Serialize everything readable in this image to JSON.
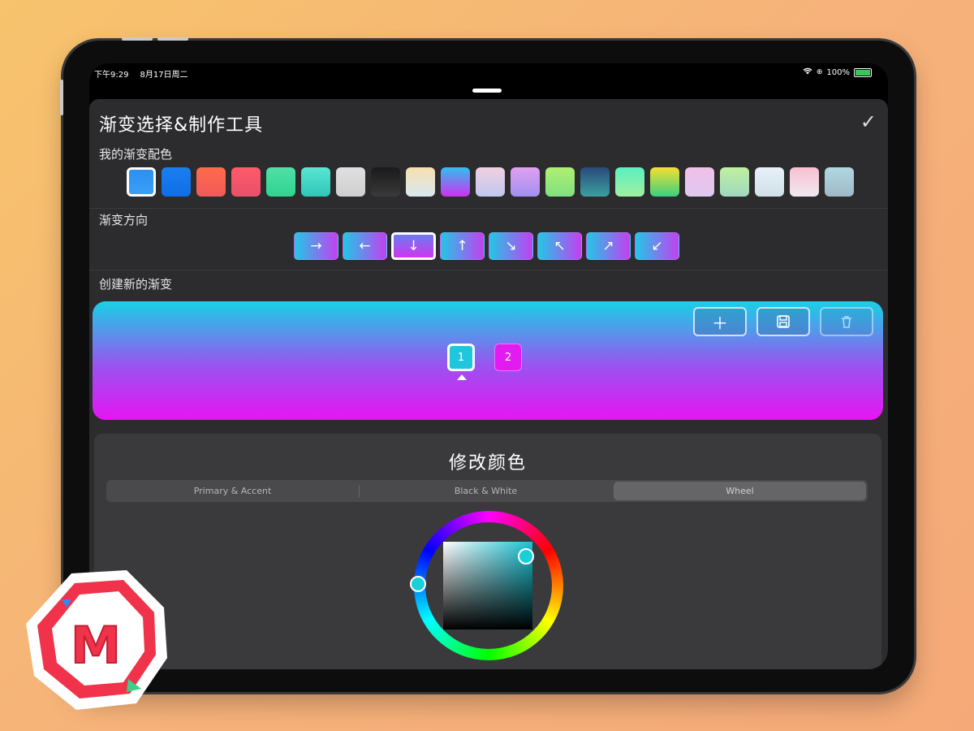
{
  "status_bar": {
    "time": "下午9:29",
    "date": "8月17日周二",
    "battery": "100%"
  },
  "header": {
    "title": "渐变选择&制作工具",
    "done_icon": "checkmark-icon"
  },
  "my_gradients": {
    "label": "我的渐变配色",
    "swatches": [
      {
        "from": "#2b8ff2",
        "to": "#3aa0f5"
      },
      {
        "from": "#1a7ff0",
        "to": "#0f6ee6"
      },
      {
        "from": "#ff6a4a",
        "to": "#f05a5a"
      },
      {
        "from": "#ff5a6a",
        "to": "#e8506a"
      },
      {
        "from": "#4fe0a8",
        "to": "#2fd38f"
      },
      {
        "from": "#5ae6d2",
        "to": "#2fc6b8"
      },
      {
        "from": "#e0e0e0",
        "to": "#cfcfcf"
      },
      {
        "from": "#1a1a1a",
        "to": "#3a3a3a"
      },
      {
        "from": "#f7e0b0",
        "to": "#d8e8f0"
      },
      {
        "from": "#2fc0ee",
        "to": "#d030f0"
      },
      {
        "from": "#f0d0e0",
        "to": "#c0c8f0"
      },
      {
        "from": "#e0a0f0",
        "to": "#a090f0"
      },
      {
        "from": "#b0f070",
        "to": "#80e080"
      },
      {
        "from": "#2a4a7a",
        "to": "#3aa0a0"
      },
      {
        "from": "#5af0c0",
        "to": "#a0f0a0"
      },
      {
        "from": "#f5e030",
        "to": "#3ad080"
      },
      {
        "from": "#f0c0e8",
        "to": "#e0c8f0"
      },
      {
        "from": "#c0f0a0",
        "to": "#a0d8c0"
      },
      {
        "from": "#e8f0f8",
        "to": "#d0e0e8"
      },
      {
        "from": "#f8c0d0",
        "to": "#f0e8f0"
      },
      {
        "from": "#b0d8e0",
        "to": "#a0b8c8"
      }
    ]
  },
  "direction": {
    "label": "渐变方向",
    "arrows": [
      "→",
      "←",
      "↓",
      "↑",
      "↘",
      "↖",
      "↗",
      "↙"
    ],
    "selected_index": 2
  },
  "create": {
    "label": "创建新的渐变",
    "add_icon": "plus-icon",
    "save_icon": "floppy-disk-icon",
    "delete_icon": "trash-icon",
    "stops": [
      {
        "label": "1",
        "color": "#1fc6dc"
      },
      {
        "label": "2",
        "color": "#e21cf0"
      }
    ],
    "gradient_from": "#18d1e6",
    "gradient_to": "#e515f2"
  },
  "editor": {
    "title": "修改颜色",
    "tabs": [
      "Primary & Accent",
      "Black & White",
      "Wheel"
    ],
    "selected_tab": "Wheel",
    "current_color": "#17c3d5"
  },
  "logo": {
    "letter": "M",
    "colors": {
      "red": "#f0334a",
      "blue": "#2a8cf0",
      "green": "#3ad08a"
    }
  }
}
